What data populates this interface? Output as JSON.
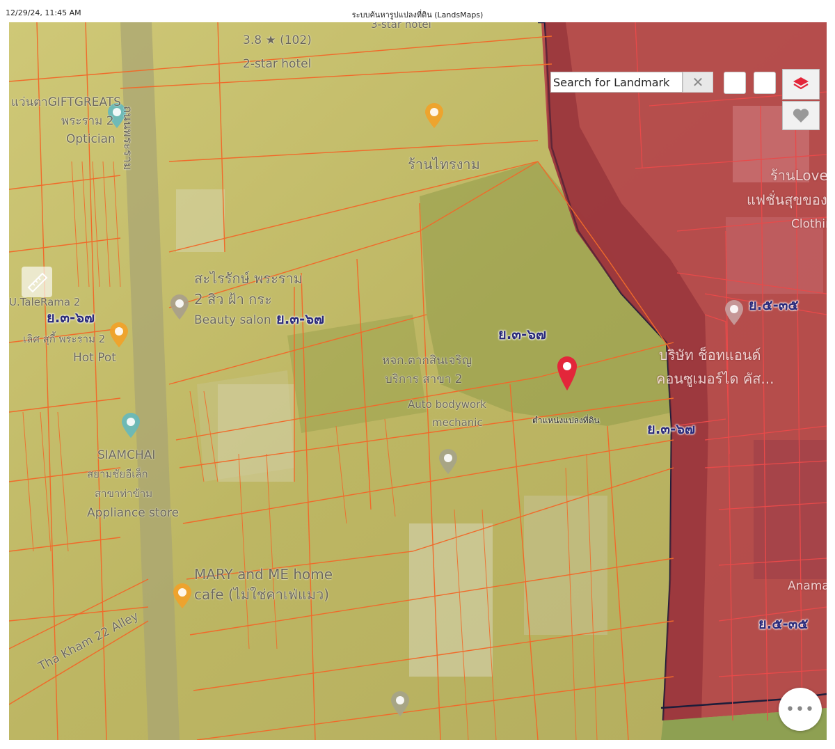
{
  "header": {
    "datetime": "12/29/24, 11:45 AM",
    "title": "ระบบค้นหารูปแปลงที่ดิน (LandsMaps)"
  },
  "search": {
    "placeholder": "Search for Landmark",
    "clear_label": "✕"
  },
  "controls": {
    "more_label": "•••",
    "layers_icon": "layers-icon",
    "favorite_icon": "heart-icon"
  },
  "colors": {
    "zone_yellow": "#c9c26a",
    "zone_red": "#b8474a",
    "parcel_line": "#f06a2a",
    "pin": "#e3263a"
  },
  "pin": {
    "label": "ตำแหน่งแปลงที่ดิน"
  },
  "zone_labels": {
    "z1": "ย.๓-๖๗",
    "z2": "ย.๓-๖๗",
    "z3": "ย.๓-๖๗",
    "z4": "ย.๓-๖๗",
    "z5": "ย.๕-๓๕",
    "z6": "ย.๕-๓๕"
  },
  "places": {
    "hotel_rating": "3.8 ★ (102)",
    "hotel_type": "2-star hotel",
    "star_hotel_top": "3-star hotel",
    "giftgreats_1": "แว่นตาGIFTGREATS",
    "giftgreats_2": "พระราม 2",
    "giftgreats_3": "Optician",
    "ran_thairam": "ร้านไทรงาม",
    "salon_1": "สะไรรักษ์ พระราม",
    "salon_2": "2 สิว ฝ้า กระ",
    "salon_3": "Beauty salon",
    "hotpot_1": "U.TaleRama 2",
    "hotpot_2": "เลิศ สุกี้ พระราม 2",
    "hotpot_3": "Hot Pot",
    "siamchai_1": "SIAMCHAI",
    "siamchai_2": "สยามชัยอีเล็ก",
    "siamchai_3": "สาขาท่าข้าม",
    "siamchai_4": "Appliance store",
    "garage_1": "หจก.ตากสินเจริญ",
    "garage_2": "บริการ สาขา 2",
    "garage_3": "Auto bodywork",
    "garage_4": "mechanic",
    "mary_1": "MARY and ME home",
    "mary_2": "cafe (ไม่ใช่คาเฟ่แมว)",
    "alley": "Tha Kham 22 Alley",
    "road": "ถนนพระราม",
    "love_1": "ร้านLove S",
    "love_2": "แฟชั่นสุขของดี",
    "love_3": "Clothing",
    "company_1": "บริษัท ช็อทแอนด์",
    "company_2": "คอนซูเมอร์ได คัส...",
    "anama": "Anama"
  }
}
